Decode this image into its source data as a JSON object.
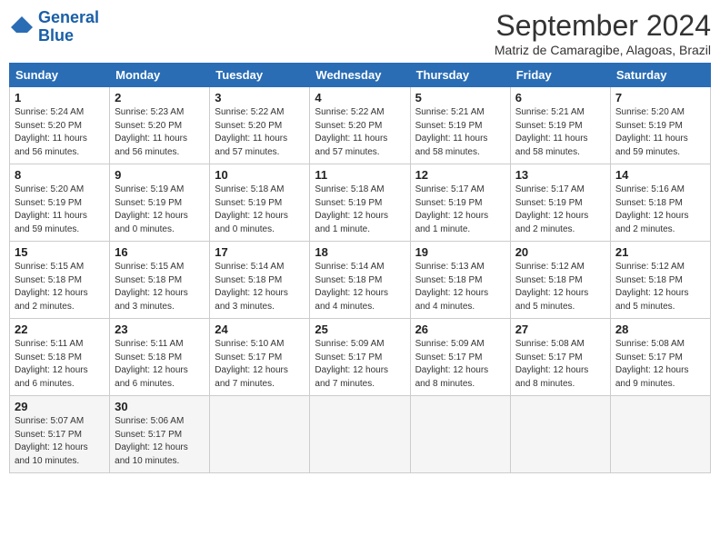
{
  "header": {
    "logo_line1": "General",
    "logo_line2": "Blue",
    "month": "September 2024",
    "location": "Matriz de Camaragibe, Alagoas, Brazil"
  },
  "weekdays": [
    "Sunday",
    "Monday",
    "Tuesday",
    "Wednesday",
    "Thursday",
    "Friday",
    "Saturday"
  ],
  "days": [
    {
      "num": "",
      "info": ""
    },
    {
      "num": "",
      "info": ""
    },
    {
      "num": "",
      "info": ""
    },
    {
      "num": "",
      "info": ""
    },
    {
      "num": "",
      "info": ""
    },
    {
      "num": "",
      "info": ""
    },
    {
      "num": "1",
      "info": "Sunrise: 5:24 AM\nSunset: 5:20 PM\nDaylight: 11 hours\nand 56 minutes."
    },
    {
      "num": "2",
      "info": "Sunrise: 5:23 AM\nSunset: 5:20 PM\nDaylight: 11 hours\nand 56 minutes."
    },
    {
      "num": "3",
      "info": "Sunrise: 5:22 AM\nSunset: 5:20 PM\nDaylight: 11 hours\nand 57 minutes."
    },
    {
      "num": "4",
      "info": "Sunrise: 5:22 AM\nSunset: 5:20 PM\nDaylight: 11 hours\nand 57 minutes."
    },
    {
      "num": "5",
      "info": "Sunrise: 5:21 AM\nSunset: 5:19 PM\nDaylight: 11 hours\nand 58 minutes."
    },
    {
      "num": "6",
      "info": "Sunrise: 5:21 AM\nSunset: 5:19 PM\nDaylight: 11 hours\nand 58 minutes."
    },
    {
      "num": "7",
      "info": "Sunrise: 5:20 AM\nSunset: 5:19 PM\nDaylight: 11 hours\nand 59 minutes."
    },
    {
      "num": "8",
      "info": "Sunrise: 5:20 AM\nSunset: 5:19 PM\nDaylight: 11 hours\nand 59 minutes."
    },
    {
      "num": "9",
      "info": "Sunrise: 5:19 AM\nSunset: 5:19 PM\nDaylight: 12 hours\nand 0 minutes."
    },
    {
      "num": "10",
      "info": "Sunrise: 5:18 AM\nSunset: 5:19 PM\nDaylight: 12 hours\nand 0 minutes."
    },
    {
      "num": "11",
      "info": "Sunrise: 5:18 AM\nSunset: 5:19 PM\nDaylight: 12 hours\nand 1 minute."
    },
    {
      "num": "12",
      "info": "Sunrise: 5:17 AM\nSunset: 5:19 PM\nDaylight: 12 hours\nand 1 minute."
    },
    {
      "num": "13",
      "info": "Sunrise: 5:17 AM\nSunset: 5:19 PM\nDaylight: 12 hours\nand 2 minutes."
    },
    {
      "num": "14",
      "info": "Sunrise: 5:16 AM\nSunset: 5:18 PM\nDaylight: 12 hours\nand 2 minutes."
    },
    {
      "num": "15",
      "info": "Sunrise: 5:15 AM\nSunset: 5:18 PM\nDaylight: 12 hours\nand 2 minutes."
    },
    {
      "num": "16",
      "info": "Sunrise: 5:15 AM\nSunset: 5:18 PM\nDaylight: 12 hours\nand 3 minutes."
    },
    {
      "num": "17",
      "info": "Sunrise: 5:14 AM\nSunset: 5:18 PM\nDaylight: 12 hours\nand 3 minutes."
    },
    {
      "num": "18",
      "info": "Sunrise: 5:14 AM\nSunset: 5:18 PM\nDaylight: 12 hours\nand 4 minutes."
    },
    {
      "num": "19",
      "info": "Sunrise: 5:13 AM\nSunset: 5:18 PM\nDaylight: 12 hours\nand 4 minutes."
    },
    {
      "num": "20",
      "info": "Sunrise: 5:12 AM\nSunset: 5:18 PM\nDaylight: 12 hours\nand 5 minutes."
    },
    {
      "num": "21",
      "info": "Sunrise: 5:12 AM\nSunset: 5:18 PM\nDaylight: 12 hours\nand 5 minutes."
    },
    {
      "num": "22",
      "info": "Sunrise: 5:11 AM\nSunset: 5:18 PM\nDaylight: 12 hours\nand 6 minutes."
    },
    {
      "num": "23",
      "info": "Sunrise: 5:11 AM\nSunset: 5:18 PM\nDaylight: 12 hours\nand 6 minutes."
    },
    {
      "num": "24",
      "info": "Sunrise: 5:10 AM\nSunset: 5:17 PM\nDaylight: 12 hours\nand 7 minutes."
    },
    {
      "num": "25",
      "info": "Sunrise: 5:09 AM\nSunset: 5:17 PM\nDaylight: 12 hours\nand 7 minutes."
    },
    {
      "num": "26",
      "info": "Sunrise: 5:09 AM\nSunset: 5:17 PM\nDaylight: 12 hours\nand 8 minutes."
    },
    {
      "num": "27",
      "info": "Sunrise: 5:08 AM\nSunset: 5:17 PM\nDaylight: 12 hours\nand 8 minutes."
    },
    {
      "num": "28",
      "info": "Sunrise: 5:08 AM\nSunset: 5:17 PM\nDaylight: 12 hours\nand 9 minutes."
    },
    {
      "num": "29",
      "info": "Sunrise: 5:07 AM\nSunset: 5:17 PM\nDaylight: 12 hours\nand 10 minutes."
    },
    {
      "num": "30",
      "info": "Sunrise: 5:06 AM\nSunset: 5:17 PM\nDaylight: 12 hours\nand 10 minutes."
    },
    {
      "num": "",
      "info": ""
    },
    {
      "num": "",
      "info": ""
    },
    {
      "num": "",
      "info": ""
    },
    {
      "num": "",
      "info": ""
    },
    {
      "num": "",
      "info": ""
    }
  ]
}
